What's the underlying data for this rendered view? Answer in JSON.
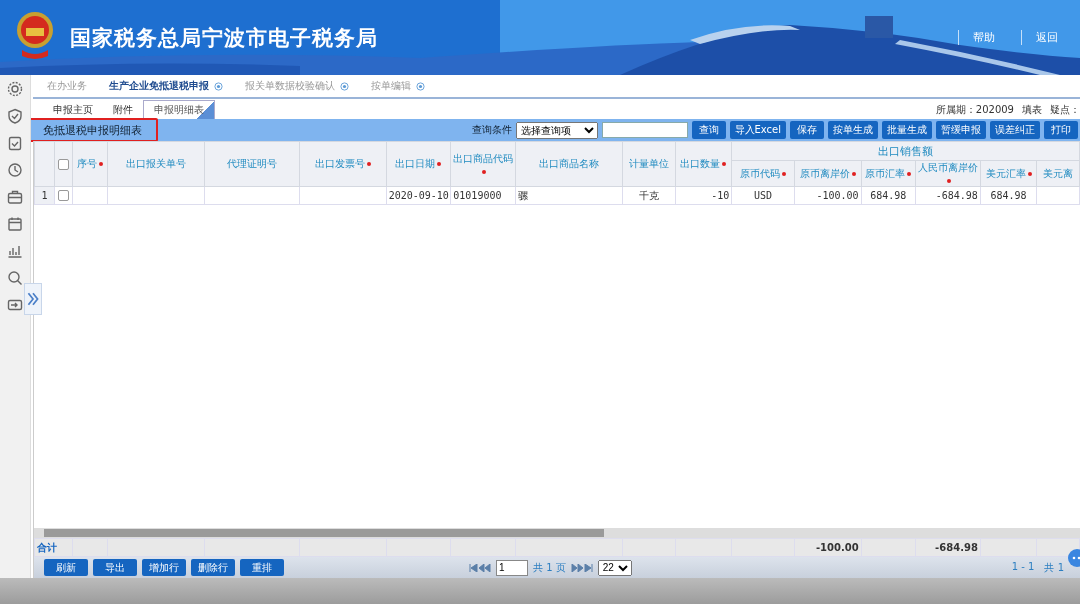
{
  "header": {
    "title": "国家税务总局宁波市电子税务局",
    "links": [
      "帮助",
      "返回"
    ]
  },
  "nav_tabs": [
    {
      "label": "在办业务",
      "selected": false,
      "closable": false
    },
    {
      "label": "生产企业免抵退税申报",
      "selected": true,
      "closable": true
    },
    {
      "label": "报关单数据校验确认",
      "selected": false,
      "closable": true
    },
    {
      "label": "按单编辑",
      "selected": false,
      "closable": true
    }
  ],
  "sub_tabs": [
    {
      "label": "申报主页",
      "selected": false
    },
    {
      "label": "附件",
      "selected": false
    },
    {
      "label": "申报明细表",
      "selected": true
    }
  ],
  "info": {
    "period_label": "所属期：",
    "period": "202009",
    "fill_label": "填表",
    "doubt_label": "疑点："
  },
  "panel": {
    "title": "免抵退税申报明细表",
    "query_label": "查询条件",
    "query_select": "选择查询项",
    "buttons": [
      "查询",
      "导入Excel",
      "保存",
      "按单生成",
      "批量生成",
      "暂缓申报",
      "误差纠正",
      "打印"
    ]
  },
  "table": {
    "select_all": {
      "checked": false
    },
    "columns": [
      {
        "label": "序号",
        "required": true
      },
      {
        "label": "出口报关单号",
        "required": false
      },
      {
        "label": "代理证明号",
        "required": false
      },
      {
        "label": "出口发票号",
        "required": true
      },
      {
        "label": "出口日期",
        "required": true
      },
      {
        "label": "出口商品代码",
        "required": true
      },
      {
        "label": "出口商品名称",
        "required": false
      },
      {
        "label": "计量单位",
        "required": false
      },
      {
        "label": "出口数量",
        "required": true
      },
      {
        "label": "出口销售额",
        "colspan": 6,
        "children": [
          {
            "label": "原币代码",
            "required": true
          },
          {
            "label": "原币离岸价",
            "required": true
          },
          {
            "label": "原币汇率",
            "required": true
          },
          {
            "label": "人民币离岸价",
            "required": true
          },
          {
            "label": "美元汇率",
            "required": true
          },
          {
            "label": "美元离",
            "required": false
          }
        ]
      }
    ],
    "rows": [
      {
        "number": "1",
        "checked": false,
        "cells": [
          null,
          null,
          null,
          null,
          "2020-09-10",
          "01019000",
          "骡",
          "千克",
          "-10",
          "USD",
          "-100.00",
          "684.98",
          "-684.98",
          "684.98",
          null
        ]
      }
    ],
    "totals": {
      "label": "合计",
      "cells": [
        null,
        null,
        null,
        null,
        null,
        null,
        null,
        null,
        null,
        null,
        "-100.00",
        null,
        "-684.98",
        null,
        null
      ]
    }
  },
  "bottom_buttons": [
    "刷新",
    "导出",
    "增加行",
    "删除行",
    "重排"
  ],
  "pager": {
    "page": "1",
    "pages": "共 1 页",
    "page_size": "22",
    "range": "1 - 1",
    "total": "共 1"
  }
}
